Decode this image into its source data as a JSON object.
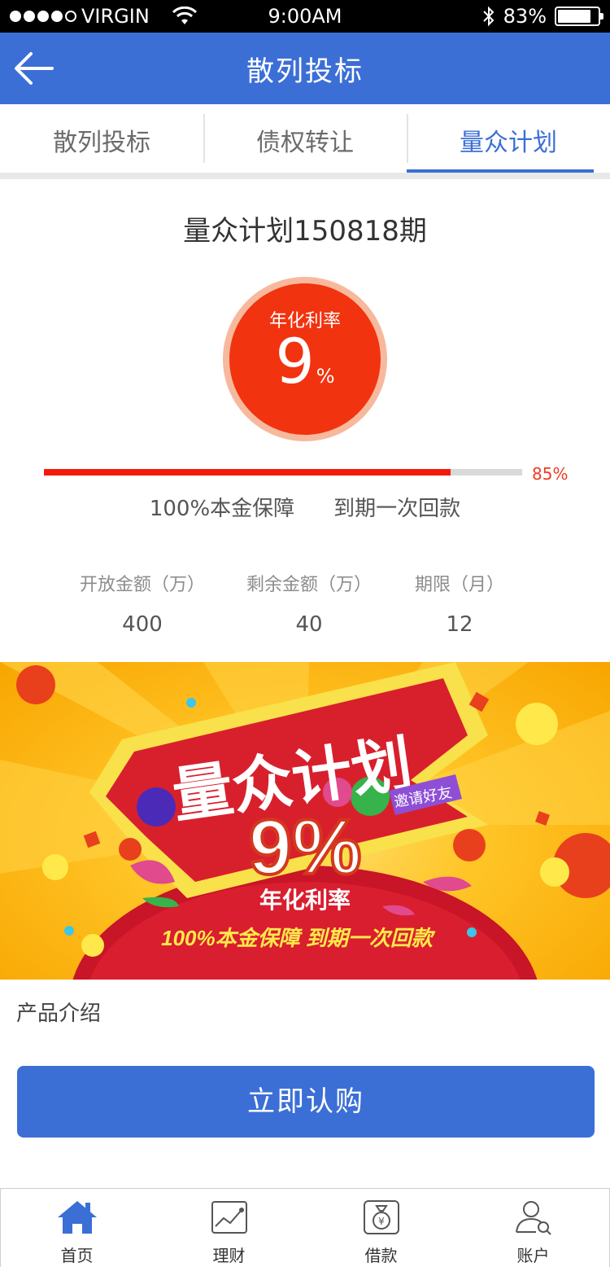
{
  "status_bar": {
    "carrier": "VIRGIN",
    "time": "9:00AM",
    "battery": "83%",
    "battery_level": 0.83
  },
  "navbar": {
    "title": "散列投标"
  },
  "tabs": [
    {
      "label": "散列投标",
      "active": false
    },
    {
      "label": "债权转让",
      "active": false
    },
    {
      "label": "量众计划",
      "active": true
    }
  ],
  "plan": {
    "title": "量众计划150818期",
    "rate_label": "年化利率",
    "rate_value": "9",
    "rate_unit": "%",
    "progress_fraction": 0.85,
    "progress_label": "85%",
    "guarantee_1": "100%本金保障",
    "guarantee_2": "到期一次回款",
    "stats": [
      {
        "label": "开放金额（万）",
        "value": "400"
      },
      {
        "label": "剩余金额（万）",
        "value": "40"
      },
      {
        "label": "期限（月）",
        "value": "12"
      }
    ]
  },
  "banner": {
    "headline": "量众计划",
    "rate": "9%",
    "rate_label": "年化利率",
    "invite": "邀请好友",
    "slogan": "100%本金保障  到期一次回款"
  },
  "intro_label": "产品介绍",
  "buy_button": "立即认购",
  "bottom_nav": [
    {
      "label": "首页",
      "icon": "home-icon"
    },
    {
      "label": "理财",
      "icon": "chart-icon"
    },
    {
      "label": "借款",
      "icon": "money-bag-icon"
    },
    {
      "label": "账户",
      "icon": "user-search-icon"
    }
  ],
  "colors": {
    "brand_blue": "#3b6fd6",
    "rate_red": "#f2330f",
    "progress_red": "#f51a0e"
  }
}
